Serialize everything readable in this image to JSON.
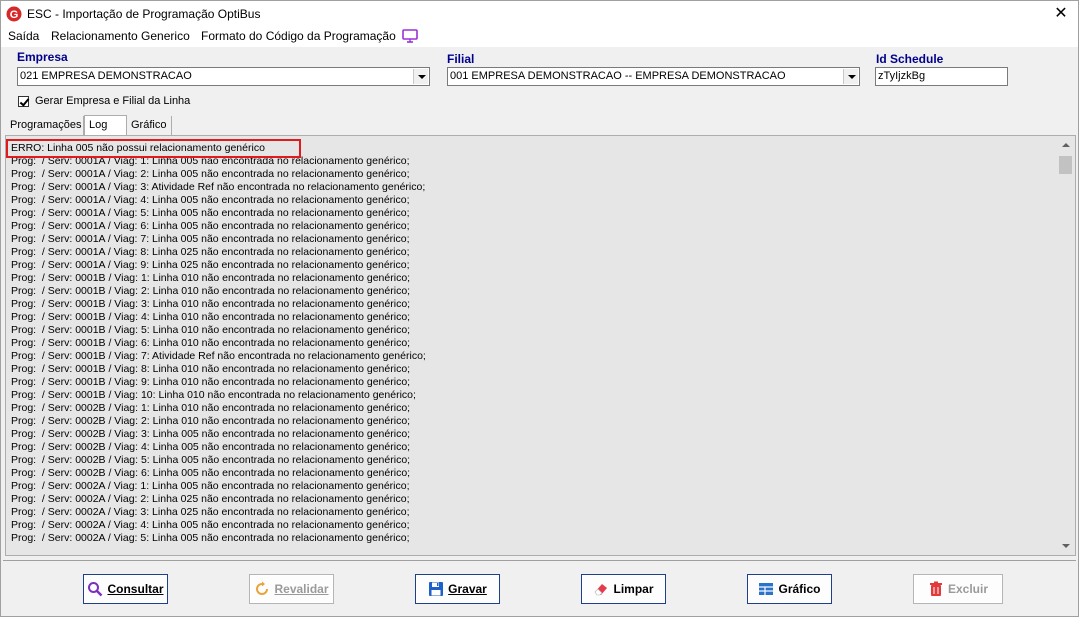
{
  "window": {
    "title": "ESC - Importação de Programação OptiBus",
    "close_glyph": "✕"
  },
  "menu": {
    "items": [
      "Saída",
      "Relacionamento Generico",
      "Formato do Código da Programação"
    ],
    "extra_icon": "monitor-icon",
    "extra_icon_color": "#9b30d9"
  },
  "form": {
    "empresa_label": "Empresa",
    "empresa_value": "021 EMPRESA DEMONSTRACAO",
    "filial_label": "Filial",
    "filial_value": "001 EMPRESA DEMONSTRACAO -- EMPRESA DEMONSTRACAO",
    "schedule_label": "Id Schedule",
    "schedule_value": "zTyIjzkBg",
    "checkbox_label": "Gerar Empresa e Filial da Linha",
    "checkbox_checked": true
  },
  "tabs": {
    "items": [
      "Programações",
      "Log",
      "Gráfico"
    ],
    "active": "Log"
  },
  "log": {
    "lines": [
      "ERRO: Linha 005 não possui relacionamento genérico",
      "Prog:  / Serv: 0001A / Viag: 1: Linha 005 não encontrada no relacionamento genérico;",
      "Prog:  / Serv: 0001A / Viag: 2: Linha 005 não encontrada no relacionamento genérico;",
      "Prog:  / Serv: 0001A / Viag: 3: Atividade Ref não encontrada no relacionamento genérico;",
      "Prog:  / Serv: 0001A / Viag: 4: Linha 005 não encontrada no relacionamento genérico;",
      "Prog:  / Serv: 0001A / Viag: 5: Linha 005 não encontrada no relacionamento genérico;",
      "Prog:  / Serv: 0001A / Viag: 6: Linha 005 não encontrada no relacionamento genérico;",
      "Prog:  / Serv: 0001A / Viag: 7: Linha 005 não encontrada no relacionamento genérico;",
      "Prog:  / Serv: 0001A / Viag: 8: Linha 025 não encontrada no relacionamento genérico;",
      "Prog:  / Serv: 0001A / Viag: 9: Linha 025 não encontrada no relacionamento genérico;",
      "Prog:  / Serv: 0001B / Viag: 1: Linha 010 não encontrada no relacionamento genérico;",
      "Prog:  / Serv: 0001B / Viag: 2: Linha 010 não encontrada no relacionamento genérico;",
      "Prog:  / Serv: 0001B / Viag: 3: Linha 010 não encontrada no relacionamento genérico;",
      "Prog:  / Serv: 0001B / Viag: 4: Linha 010 não encontrada no relacionamento genérico;",
      "Prog:  / Serv: 0001B / Viag: 5: Linha 010 não encontrada no relacionamento genérico;",
      "Prog:  / Serv: 0001B / Viag: 6: Linha 010 não encontrada no relacionamento genérico;",
      "Prog:  / Serv: 0001B / Viag: 7: Atividade Ref não encontrada no relacionamento genérico;",
      "Prog:  / Serv: 0001B / Viag: 8: Linha 010 não encontrada no relacionamento genérico;",
      "Prog:  / Serv: 0001B / Viag: 9: Linha 010 não encontrada no relacionamento genérico;",
      "Prog:  / Serv: 0001B / Viag: 10: Linha 010 não encontrada no relacionamento genérico;",
      "Prog:  / Serv: 0002B / Viag: 1: Linha 010 não encontrada no relacionamento genérico;",
      "Prog:  / Serv: 0002B / Viag: 2: Linha 010 não encontrada no relacionamento genérico;",
      "Prog:  / Serv: 0002B / Viag: 3: Linha 005 não encontrada no relacionamento genérico;",
      "Prog:  / Serv: 0002B / Viag: 4: Linha 005 não encontrada no relacionamento genérico;",
      "Prog:  / Serv: 0002B / Viag: 5: Linha 005 não encontrada no relacionamento genérico;",
      "Prog:  / Serv: 0002B / Viag: 6: Linha 005 não encontrada no relacionamento genérico;",
      "Prog:  / Serv: 0002A / Viag: 1: Linha 005 não encontrada no relacionamento genérico;",
      "Prog:  / Serv: 0002A / Viag: 2: Linha 025 não encontrada no relacionamento genérico;",
      "Prog:  / Serv: 0002A / Viag: 3: Linha 025 não encontrada no relacionamento genérico;",
      "Prog:  / Serv: 0002A / Viag: 4: Linha 005 não encontrada no relacionamento genérico;",
      "Prog:  / Serv: 0002A / Viag: 5: Linha 005 não encontrada no relacionamento genérico;"
    ],
    "highlight_color": "#e11b1b"
  },
  "buttons": {
    "consultar": {
      "label": "Consultar",
      "icon": "magnifier-icon",
      "enabled": true
    },
    "revalidar": {
      "label": "Revalidar",
      "icon": "refresh-icon",
      "enabled": false
    },
    "gravar": {
      "label": "Gravar",
      "icon": "floppy-disk-icon",
      "enabled": true
    },
    "limpar": {
      "label": "Limpar",
      "icon": "eraser-icon",
      "enabled": true
    },
    "grafico": {
      "label": "Gráfico",
      "icon": "grid-chart-icon",
      "enabled": true
    },
    "excluir": {
      "label": "Excluir",
      "icon": "trash-icon",
      "enabled": false
    }
  },
  "colors": {
    "label_blue": "#00008b",
    "button_border": "#1f3f8c",
    "app_icon_red": "#d62828"
  }
}
